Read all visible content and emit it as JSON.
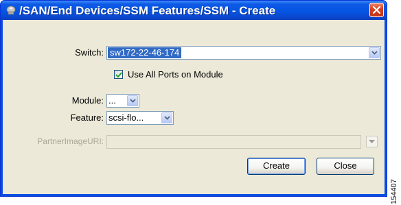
{
  "window": {
    "title": "/SAN/End Devices/SSM Features/SSM - Create",
    "title_icon": "fabric-manager-icon",
    "close_icon": "close-icon"
  },
  "form": {
    "switch_label": "Switch:",
    "switch_value": "sw172-22-46-174",
    "use_all_ports_label": "Use All Ports on Module",
    "use_all_ports_checked": true,
    "module_label": "Module:",
    "module_value": "...",
    "feature_label": "Feature:",
    "feature_value": "scsi-flo...",
    "partner_image_label": "PartnerImageURI:",
    "partner_image_value": ""
  },
  "buttons": {
    "create_label": "Create",
    "close_label": "Close"
  },
  "figure_id": "154407",
  "colors": {
    "titlebar": "#0555e2",
    "client_bg": "#ece9d8",
    "selection": "#316ac5",
    "close_button": "#d6401f"
  }
}
